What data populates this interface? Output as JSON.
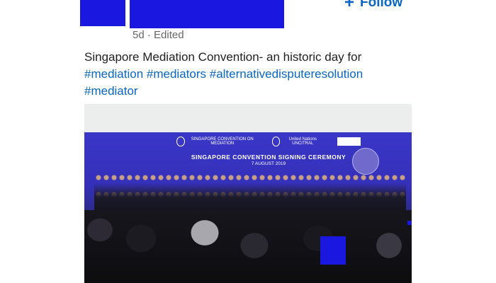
{
  "post": {
    "meta": "5d · Edited",
    "follow_label": "Follow",
    "text": "Singapore Mediation Convention- an historic day for",
    "hashtags": [
      "#mediation",
      "#mediators",
      "#alternativedisputeresolution",
      "#mediator"
    ]
  },
  "image": {
    "banner_logo_1": "SINGAPORE CONVENTION ON MEDIATION",
    "banner_logo_2": "United Nations UNCITRAL",
    "banner_title": "SINGAPORE CONVENTION SIGNING CEREMONY",
    "banner_date": "7 AUGUST 2019"
  },
  "colors": {
    "hashtag": "#0a66c2",
    "redaction": "#1a18e0"
  }
}
